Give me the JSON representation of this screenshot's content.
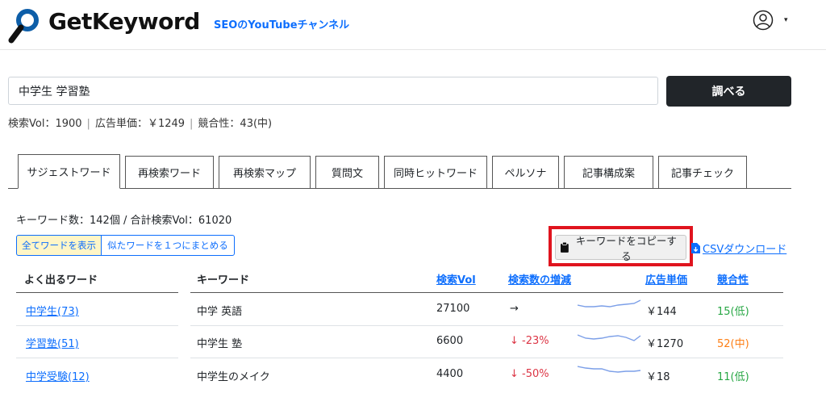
{
  "header": {
    "logo_text": "GetKeyword",
    "youtube_link": "SEOのYouTubeチャンネル",
    "caret": "▾"
  },
  "search": {
    "value": "中学生 学習塾",
    "button": "調べる"
  },
  "metrics": {
    "volume": "検索Vol：1900",
    "cpc": "広告単価：￥1249",
    "competition": "競合性：43(中)",
    "separator": "|"
  },
  "tabs": [
    {
      "label": "サジェストワード",
      "active": true
    },
    {
      "label": "再検索ワード"
    },
    {
      "label": "再検索マップ"
    },
    {
      "label": "質問文"
    },
    {
      "label": "同時ヒットワード"
    },
    {
      "label": "ペルソナ"
    },
    {
      "label": "記事構成案"
    },
    {
      "label": "記事チェック"
    }
  ],
  "keyword_count": "キーワード数：142個 / 合計検索Vol：61020",
  "toggles": {
    "show_all": "全てワードを表示",
    "group_similar": "似たワードを１つにまとめる"
  },
  "copy_button": "キーワードをコピーする",
  "csv_link": "CSVダウンロード",
  "frequent": {
    "header": "よく出るワード",
    "items": [
      "中学生(73)",
      "学習塾(51)",
      "中学受験(12)"
    ]
  },
  "table": {
    "headers": {
      "keyword": "キーワード",
      "volume": "検索Vol",
      "trend": "検索数の増減",
      "cpc": "広告単価",
      "competition": "競合性"
    },
    "rows": [
      {
        "keyword": "中学 英語",
        "volume": "27100",
        "trend": "→",
        "cpc": "￥144",
        "competition": "15(低)"
      },
      {
        "keyword": "中学生 塾",
        "volume": "6600",
        "trend": "↓ -23%",
        "cpc": "￥1270",
        "competition": "52(中)"
      },
      {
        "keyword": "中学生のメイク",
        "volume": "4400",
        "trend": "↓ -50%",
        "cpc": "￥18",
        "competition": "11(低)"
      }
    ]
  },
  "colors": {
    "accent": "#0d6efd",
    "highlight_border": "#e0141e",
    "dark_button": "#212529",
    "low": "#28a745",
    "mid": "#fd7e14",
    "down": "#dc3545"
  }
}
